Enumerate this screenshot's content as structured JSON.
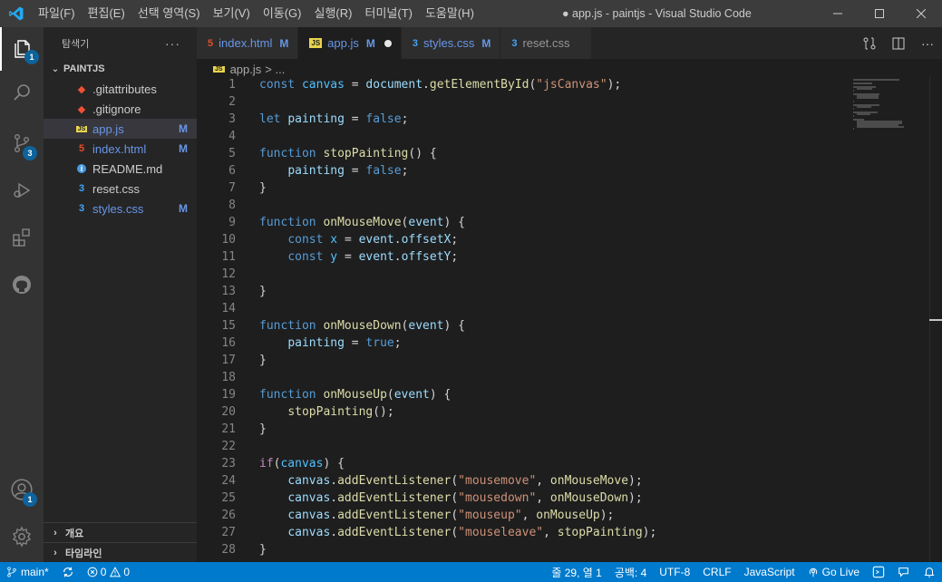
{
  "window": {
    "title": "● app.js - paintjs - Visual Studio Code"
  },
  "menu": [
    "파일(F)",
    "편집(E)",
    "선택 영역(S)",
    "보기(V)",
    "이동(G)",
    "실행(R)",
    "터미널(T)",
    "도움말(H)"
  ],
  "activity": {
    "explorer_badge": "1",
    "scm_badge": "3",
    "accounts_badge": "1"
  },
  "sidebar": {
    "title": "탐색기",
    "more": "···",
    "project": "PAINTJS",
    "files": [
      {
        "name": ".gitattributes",
        "icon": "git-icon",
        "status": "",
        "color": "#cccccc"
      },
      {
        "name": ".gitignore",
        "icon": "git-icon",
        "status": "",
        "color": "#cccccc"
      },
      {
        "name": "app.js",
        "icon": "js-icon",
        "status": "M",
        "color": "#6996e6"
      },
      {
        "name": "index.html",
        "icon": "html-icon",
        "status": "M",
        "color": "#6996e6"
      },
      {
        "name": "README.md",
        "icon": "info-icon",
        "status": "",
        "color": "#cccccc"
      },
      {
        "name": "reset.css",
        "icon": "css-icon",
        "status": "",
        "color": "#cccccc"
      },
      {
        "name": "styles.css",
        "icon": "css-icon",
        "status": "M",
        "color": "#6996e6"
      }
    ],
    "outline": "개요",
    "timeline": "타임라인"
  },
  "tabs": [
    {
      "label": "index.html",
      "status": "M"
    },
    {
      "label": "app.js",
      "status": "M"
    },
    {
      "label": "styles.css",
      "status": "M"
    },
    {
      "label": "reset.css",
      "status": ""
    }
  ],
  "breadcrumb": {
    "file": "app.js",
    "sep": "> ..."
  },
  "statusbar": {
    "branch": "main*",
    "errors": "0",
    "warnings": "0",
    "position": "줄 29, 열 1",
    "spaces": "공백: 4",
    "encoding": "UTF-8",
    "eol": "CRLF",
    "language": "JavaScript",
    "golive": "Go Live"
  },
  "code_lines": [
    "const canvas = document.getElementById(\"jsCanvas\");",
    "",
    "let painting = false;",
    "",
    "function stopPainting() {",
    "    painting = false;",
    "}",
    "",
    "function onMouseMove(event) {",
    "    const x = event.offsetX;",
    "    const y = event.offsetY;",
    "",
    "}",
    "",
    "function onMouseDown(event) {",
    "    painting = true;",
    "}",
    "",
    "function onMouseUp(event) {",
    "    stopPainting();",
    "}",
    "",
    "if(canvas) {",
    "    canvas.addEventListener(\"mousemove\", onMouseMove);",
    "    canvas.addEventListener(\"mousedown\", onMouseDown);",
    "    canvas.addEventListener(\"mouseup\", onMouseUp);",
    "    canvas.addEventListener(\"mouseleave\", stopPainting);",
    "}"
  ]
}
